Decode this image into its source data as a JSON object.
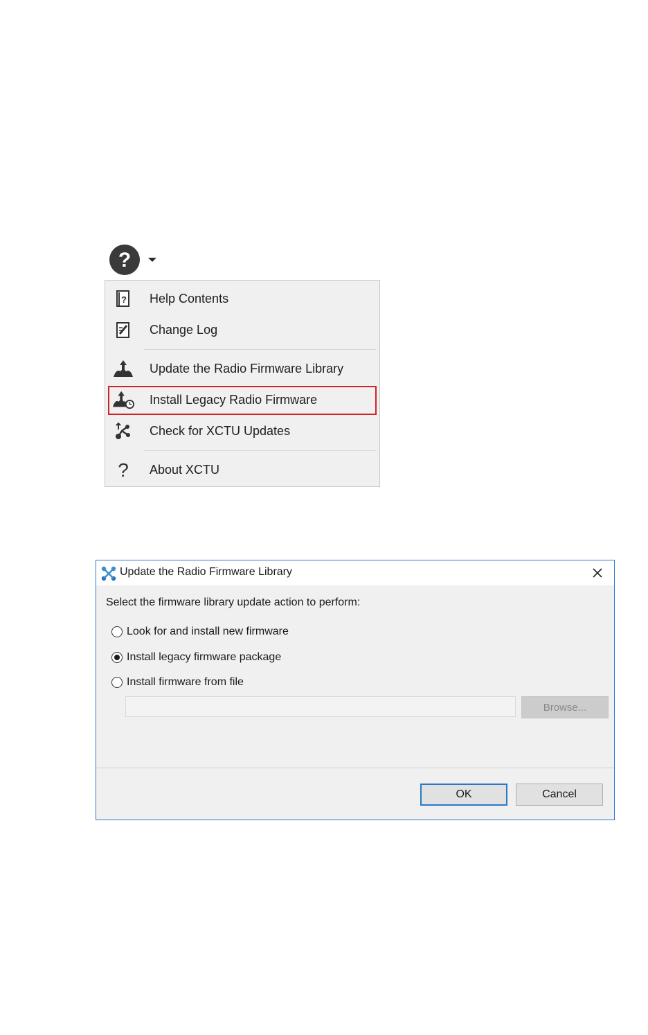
{
  "help_button": {
    "icon": "help-icon",
    "dropdown_icon": "chevron-down-icon"
  },
  "menu": {
    "items": [
      {
        "label": "Help Contents",
        "icon": "help-book-icon"
      },
      {
        "label": "Change Log",
        "icon": "changelog-icon"
      },
      {
        "label": "Update the Radio Firmware Library",
        "icon": "firmware-update-icon"
      },
      {
        "label": "Install Legacy Radio Firmware",
        "icon": "legacy-firmware-icon",
        "highlighted": true
      },
      {
        "label": "Check for XCTU Updates",
        "icon": "xctu-updates-icon"
      },
      {
        "label": "About XCTU",
        "icon": "question-icon"
      }
    ],
    "highlight_color": "#d0222a"
  },
  "dialog": {
    "title": "Update the Radio Firmware Library",
    "instruction": "Select the firmware library update action to perform:",
    "options": [
      {
        "label": "Look for and install new firmware",
        "selected": false
      },
      {
        "label": "Install legacy firmware package",
        "selected": true
      },
      {
        "label": "Install firmware from file",
        "selected": false
      }
    ],
    "file_path_value": "",
    "browse_label": "Browse...",
    "ok_label": "OK",
    "cancel_label": "Cancel",
    "accent_color": "#2b78c6"
  }
}
